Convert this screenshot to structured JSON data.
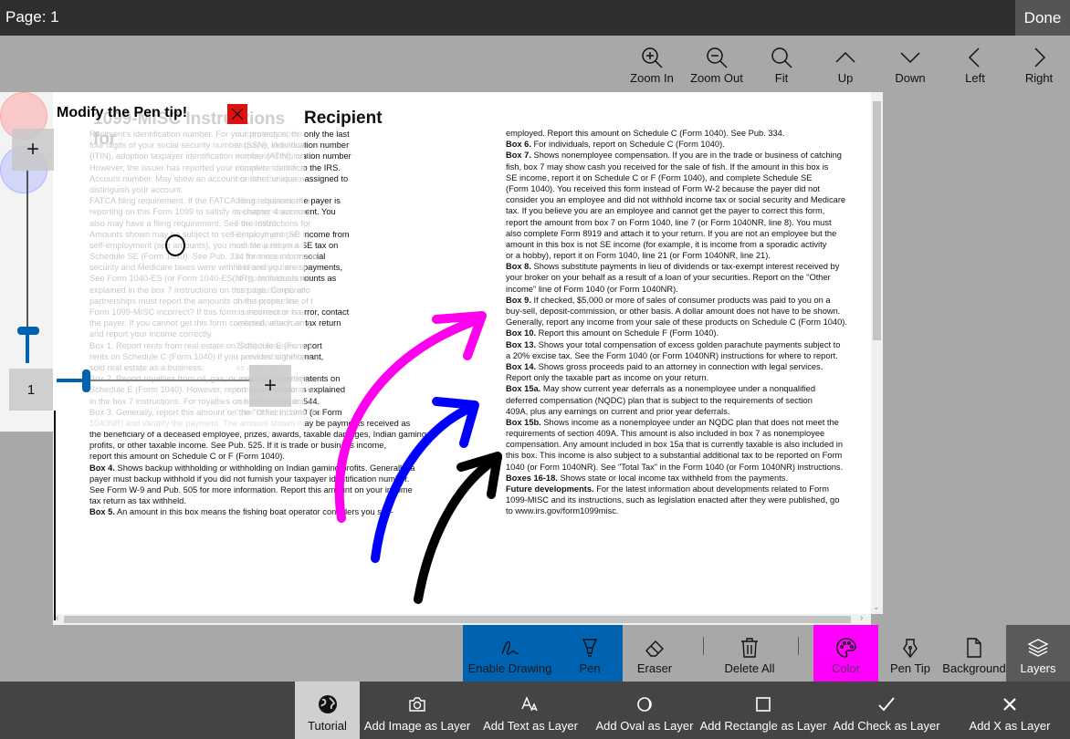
{
  "topbar": {
    "page_label": "Page: 1",
    "done_label": "Done"
  },
  "nav": [
    {
      "id": "zoom-in",
      "label": "Zoom In",
      "icon": "zoom-in-icon"
    },
    {
      "id": "zoom-out",
      "label": "Zoom Out",
      "icon": "zoom-out-icon"
    },
    {
      "id": "fit",
      "label": "Fit",
      "icon": "search-icon"
    },
    {
      "id": "up",
      "label": "Up",
      "icon": "chevron-up-icon"
    },
    {
      "id": "down",
      "label": "Down",
      "icon": "chevron-down-icon"
    },
    {
      "id": "left",
      "label": "Left",
      "icon": "chevron-left-icon"
    },
    {
      "id": "right",
      "label": "Right",
      "icon": "chevron-right-icon"
    }
  ],
  "pen_panel": {
    "title": "Modify the Pen tip!",
    "page_number": "1",
    "size_value": 0.12
  },
  "document": {
    "title": "Recipient",
    "faded_title": "1099-MISC Instructions for",
    "faded_lines": [
      "Recipient's identification number. For your protection, th",
      "four digits of your social security number (SSN), individual",
      "(ITIN), adoption taxpayer identification number (ATIN), or e",
      "However, the issuer has reported your complete identifica",
      "Account number. May show an account or other unique n",
      "distinguish your account.",
      "FATCA filing requirement. If the FATCA filing requirement b",
      "reporting on this Form 1099 to satisfy its chapter 4 account",
      "also may have a filing requirement. See the Instructions for",
      "Amounts shown may be subject to self-employment (SE",
      "self-employment (see amounts), you must file a return a",
      "Schedule SE (Form 1040). See Pub. 334 for more informatio",
      "security and Medicare taxes were withheld and you are st",
      "See Form 1040-ES (or Form 1040-ES(NR)). Individuals mu",
      "explained in the box 7 instructions on this page. Corporatio",
      "partnerships must report the amounts on the proper line of t",
      "Form 1099-MISC incorrect? If this form is incorrect or ha",
      "the payer. If you cannot get this form corrected, attach an e",
      "and report your income correctly.",
      "Box 1. Report rents from real estate on Schedule E (Form 1",
      "rents on Schedule C (Form 1040) if you provided significan",
      "sold real estate as a business.",
      "Box 2. Report royalties from oil, gas, or mineral properties,",
      "Schedule E (Form 1040). However, report payments for a w",
      "in the box 7 instructions. For royalties on timber, coal, and ir",
      "Box 3. Generally, report this amount on the \"Other income\" lin"
    ],
    "left_lines": [
      {
        "b": "",
        "t": "                                                              is form may show only the last"
      },
      {
        "b": "",
        "t": "                                                              taxpayer identification number"
      },
      {
        "b": "",
        "t": "                                                              employer identification number"
      },
      {
        "b": "",
        "t": "                                                              tification number to the IRS."
      },
      {
        "b": "",
        "t": "                                                              number the payer assigned to"
      },
      {
        "b": "",
        "t": ""
      },
      {
        "b": "",
        "t": "                                                              box is checked, the payer is"
      },
      {
        "b": "",
        "t": "                                                              reporting requirement. You"
      },
      {
        "b": "",
        "t": "                                                              Form 8938."
      },
      {
        "b": "",
        "t": "                                                              E) tax. If your net income from"
      },
      {
        "b": "",
        "t": "                                                              nd compute your SE tax on"
      },
      {
        "b": "",
        "t": "                                                              n. If no income or social"
      },
      {
        "b": "",
        "t": "                                                              ill receiving these payments,"
      },
      {
        "b": "",
        "t": "                                                              st report these amounts as"
      },
      {
        "b": "",
        "t": "                                                              ons, fiduciaries, or"
      },
      {
        "b": "",
        "t": "                                                              their tax returns."
      },
      {
        "b": "",
        "t": "                                                              s been issued in error, contact"
      },
      {
        "b": "",
        "t": "                                                              xplanation to your tax return"
      },
      {
        "b": "",
        "t": ""
      },
      {
        "b": "",
        "t": "                                                              1040). However, report"
      },
      {
        "b": "",
        "t": "                                                              t services to the tenant,"
      },
      {
        "b": "",
        "t": "                                                              as a business."
      },
      {
        "b": "",
        "t": "                                                              , copyrights, and patents on"
      },
      {
        "b": "",
        "t": "                                                              working interest as explained"
      },
      {
        "b": "",
        "t": "                                                              ron ore, see Pub. 544."
      },
      {
        "b": "",
        "t": "                                                              \" line of Form 1040 (or Form"
      },
      {
        "b": "",
        "t": "1040NR) and identify the payment. The amount shown may be payments received as"
      },
      {
        "b": "",
        "t": "the beneficiary of a deceased employee, prizes, awards, taxable damages, Indian gaming"
      },
      {
        "b": "",
        "t": "profits, or other taxable income. See Pub. 525. If it is trade or business income,"
      },
      {
        "b": "",
        "t": "report this amount on Schedule C or F (Form 1040)."
      },
      {
        "b": "Box 4.",
        "t": " Shows backup withholding or withholding on Indian gaming profits. Generally, a"
      },
      {
        "b": "",
        "t": "payer must backup withhold if you did not furnish your taxpayer identification number."
      },
      {
        "b": "",
        "t": "See Form W-9 and Pub. 505 for more information. Report this amount on your income"
      },
      {
        "b": "",
        "t": "tax return as tax withheld."
      },
      {
        "b": "Box 5.",
        "t": " An amount in this box means the fishing boat operator considers you self-"
      }
    ],
    "right_lines": [
      {
        "b": "",
        "t": "employed. Report this amount on Schedule C (Form 1040). See Pub. 334."
      },
      {
        "b": "Box 6.",
        "t": " For individuals, report on Schedule C (Form 1040)."
      },
      {
        "b": "Box 7.",
        "t": " Shows nonemployee compensation. If you are in the trade or business of catching"
      },
      {
        "b": "",
        "t": "fish, box 7 may show cash you received for the sale of fish. If the amount in this box is"
      },
      {
        "b": "",
        "t": "SE income, report it on Schedule C or F (Form 1040), and complete Schedule SE"
      },
      {
        "b": "",
        "t": "(Form 1040). You received this form instead of Form W-2 because the payer did not"
      },
      {
        "b": "",
        "t": "consider you an employee and did not withhold income tax or social security and Medicare"
      },
      {
        "b": "",
        "t": "tax. If you believe you are an employee and cannot get the payer to correct this form,"
      },
      {
        "b": "",
        "t": "report the amount from box 7 on Form 1040, line 7 (or Form 1040NR, line 8). You must"
      },
      {
        "b": "",
        "t": "also complete Form 8919 and attach it to your return. If you are not an employee but the"
      },
      {
        "b": "",
        "t": "amount in this box is not SE income (for example, it is income from a sporadic activity"
      },
      {
        "b": "",
        "t": "or a hobby), report it on Form 1040, line 21 (or Form 1040NR, line 21)."
      },
      {
        "b": "Box 8.",
        "t": " Shows substitute payments in lieu of dividends or tax-exempt interest received by"
      },
      {
        "b": "",
        "t": "your broker on your behalf as a result of a loan of your securities. Report on the \"Other"
      },
      {
        "b": "",
        "t": "income\" line of Form 1040 (or Form 1040NR)."
      },
      {
        "b": "Box 9.",
        "t": " If checked, $5,000 or more of sales of consumer products was paid to you on a"
      },
      {
        "b": "",
        "t": "buy-sell, deposit-commission, or other basis. A dollar amount does not have to be shown."
      },
      {
        "b": "",
        "t": "Generally, report any income from your sale of these products on Schedule C (Form 1040)."
      },
      {
        "b": "Box 10.",
        "t": " Report this amount on Schedule F (Form 1040)."
      },
      {
        "b": "Box 13.",
        "t": " Shows your total compensation of excess golden parachute payments subject to"
      },
      {
        "b": "",
        "t": "a 20% excise tax. See the Form 1040 (or Form 1040NR) instructions for where to report."
      },
      {
        "b": "Box 14.",
        "t": " Shows gross proceeds paid to an attorney in connection with legal services."
      },
      {
        "b": "",
        "t": "Report only the taxable part as income on your return."
      },
      {
        "b": "Box 15a.",
        "t": " May show current year deferrals as a nonemployee under a nonqualified"
      },
      {
        "b": "",
        "t": "deferred compensation (NQDC) plan that is subject to the requirements of section"
      },
      {
        "b": "",
        "t": "409A, plus any earnings on current and prior year deferrals."
      },
      {
        "b": "Box 15b.",
        "t": " Shows income as a nonemployee under an NQDC plan that does not meet the"
      },
      {
        "b": "",
        "t": "requirements of section 409A. This amount is also included in box 7 as nonemployee"
      },
      {
        "b": "",
        "t": "compensation. Any amount included in box 15a that is currently taxable is also included in"
      },
      {
        "b": "",
        "t": "this box. This income is also subject to a substantial additional tax to be reported on Form"
      },
      {
        "b": "",
        "t": "1040 (or Form 1040NR). See \"Total Tax\" in the Form 1040 (or Form 1040NR) instructions."
      },
      {
        "b": "Boxes 16-18.",
        "t": " Shows state or local income tax withheld from the payments."
      },
      {
        "b": "Future developments.",
        "t": " For the latest information about developments related to Form"
      },
      {
        "b": "",
        "t": "1099-MISC and its instructions, such as legislation enacted after they were published, go"
      },
      {
        "b": "",
        "t": "to www.irs.gov/form1099misc."
      }
    ]
  },
  "drawing_tools": {
    "enable_drawing": "Enable Drawing",
    "pen": "Pen",
    "eraser": "Eraser",
    "delete_all": "Delete All",
    "color": "Color",
    "pen_tip": "Pen Tip",
    "background": "Background",
    "layers": "Layers"
  },
  "layer_tools": [
    {
      "id": "tutorial",
      "label": "Tutorial",
      "icon": "globe-icon"
    },
    {
      "id": "add-image",
      "label": "Add Image as Layer",
      "icon": "camera-icon"
    },
    {
      "id": "add-text",
      "label": "Add Text as Layer",
      "icon": "text-size-icon"
    },
    {
      "id": "add-oval",
      "label": "Add Oval as Layer",
      "icon": "oval-icon"
    },
    {
      "id": "add-rectangle",
      "label": "Add Rectangle as Layer",
      "icon": "rectangle-icon"
    },
    {
      "id": "add-check",
      "label": "Add Check as Layer",
      "icon": "check-icon"
    },
    {
      "id": "add-x",
      "label": "Add X as Layer",
      "icon": "x-icon"
    }
  ],
  "colors": {
    "accent_blue": "#0063b1",
    "selected_color": "#ff00ff",
    "stroke_magenta": "#ff00ee",
    "stroke_blue": "#0000ff",
    "stroke_black": "#000000"
  }
}
